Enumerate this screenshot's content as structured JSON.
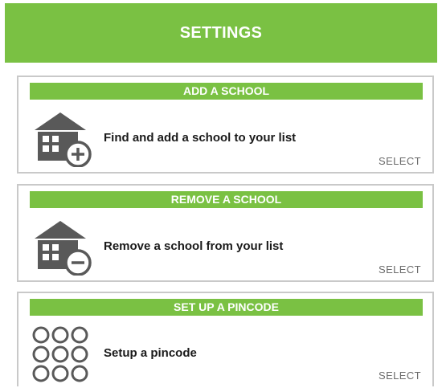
{
  "header": {
    "title": "SETTINGS"
  },
  "cards": [
    {
      "band_label": "ADD A SCHOOL",
      "icon": "school-add-icon",
      "description": "Find and add a school to your list",
      "action_label": "SELECT"
    },
    {
      "band_label": "REMOVE A SCHOOL",
      "icon": "school-remove-icon",
      "description": "Remove a school from your list",
      "action_label": "SELECT"
    },
    {
      "band_label": "SET UP A PINCODE",
      "icon": "pincode-grid-icon",
      "description": "Setup a pincode",
      "action_label": "SELECT"
    }
  ],
  "colors": {
    "accent": "#7ac143",
    "icon": "#595959",
    "card_border": "#c9c9c9",
    "select_text": "#6b6b6b"
  }
}
